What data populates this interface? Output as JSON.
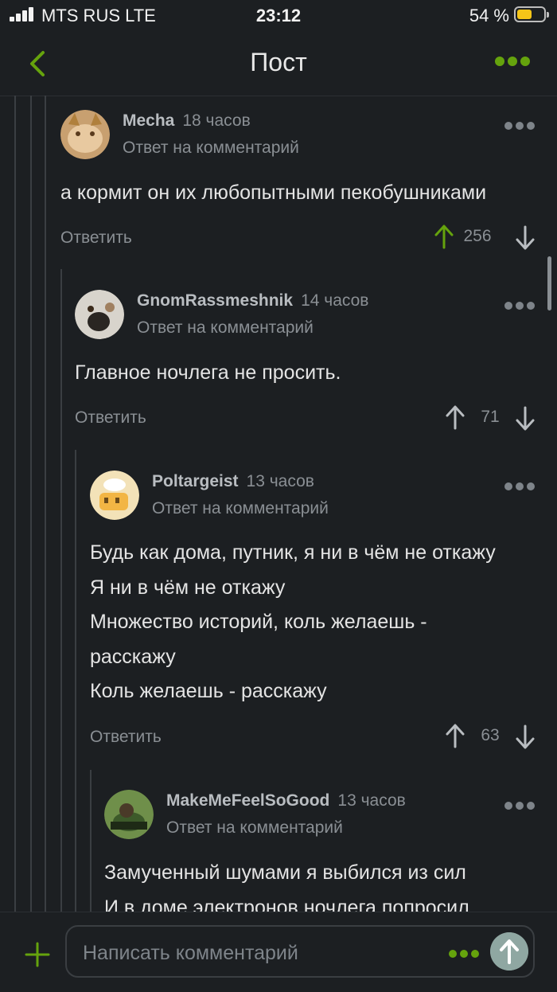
{
  "status": {
    "carrier": "MTS RUS  LTE",
    "time": "23:12",
    "battery": "54 %"
  },
  "header": {
    "title": "Пост"
  },
  "reply_label": "Ответить",
  "reply_of_label": "Ответ на комментарий",
  "comments": [
    {
      "user": "Mecha",
      "ago": "18 часов",
      "lines": [
        "а кормит он их любопытными пекобушниками"
      ],
      "votes": "256"
    },
    {
      "user": "GnomRassmeshnik",
      "ago": "14 часов",
      "lines": [
        "Главное ночлега не просить."
      ],
      "votes": "71"
    },
    {
      "user": "Poltargeist",
      "ago": "13 часов",
      "lines": [
        "Будь как дома, путник, я ни в чём не откажу",
        "Я ни в чём не откажу",
        "Множество историй, коль желаешь -",
        "расскажу",
        "Коль желаешь - расскажу"
      ],
      "votes": "63"
    },
    {
      "user": "MakeMeFeelSoGood",
      "ago": "13 часов",
      "lines": [
        "Замученный шумами я выбился из сил",
        "И в доме электронов ночлега попросил"
      ]
    }
  ],
  "composer": {
    "placeholder": "Написать комментарий"
  },
  "colors": {
    "accent": "#65a30d",
    "background": "#1c1f22"
  }
}
